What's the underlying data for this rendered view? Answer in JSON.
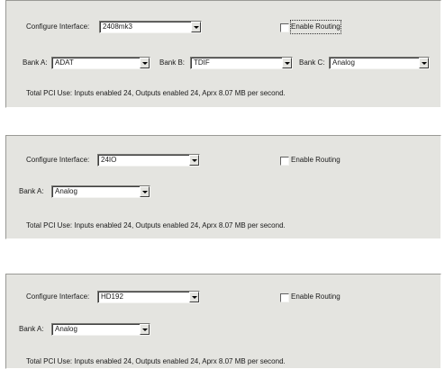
{
  "panels": [
    {
      "configure_label": "Configure Interface:",
      "interface_value": "2408mk3",
      "routing_label": "Enable Routing",
      "bank_a_label": "Bank A:",
      "bank_a_value": "ADAT",
      "bank_b_label": "Bank B:",
      "bank_b_value": "TDIF",
      "bank_c_label": "Bank C:",
      "bank_c_value": "Analog",
      "pci_text": "Total PCI Use: Inputs enabled 24, Outputs enabled 24, Aprx 8.07 MB per second."
    },
    {
      "configure_label": "Configure Interface:",
      "interface_value": "24IO",
      "routing_label": "Enable Routing",
      "bank_a_label": "Bank A:",
      "bank_a_value": "Analog",
      "pci_text": "Total PCI Use: Inputs enabled 24, Outputs enabled 24, Aprx 8.07 MB per second."
    },
    {
      "configure_label": "Configure Interface:",
      "interface_value": "HD192",
      "routing_label": "Enable Routing",
      "bank_a_label": "Bank A:",
      "bank_a_value": "Analog",
      "pci_text": "Total PCI Use: Inputs enabled 24, Outputs enabled 24, Aprx 8.07 MB per second."
    }
  ],
  "icons": {
    "dropdown_arrow": "chevron-down-icon",
    "checkbox": "checkbox-icon"
  }
}
